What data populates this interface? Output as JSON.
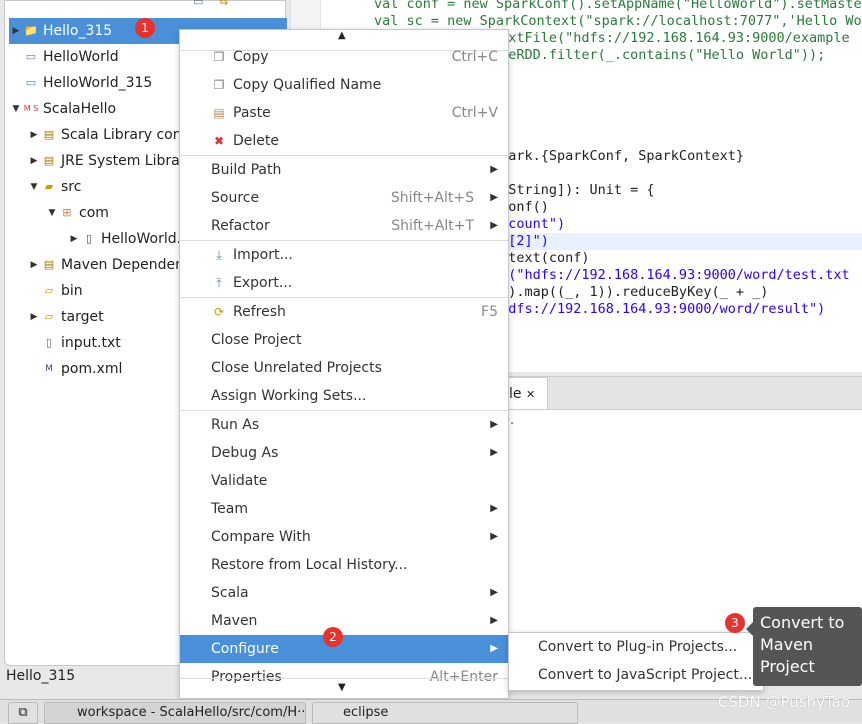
{
  "explorer": {
    "items": [
      {
        "label": "Hello_315",
        "selected": true,
        "icon": "maven-scala-project-icon"
      },
      {
        "label": "HelloWorld",
        "icon": "folder-project-icon"
      },
      {
        "label": "HelloWorld_315",
        "icon": "folder-project-icon"
      },
      {
        "label": "ScalaHello",
        "icon": "maven-scala-project-icon"
      },
      {
        "label": "Scala Library conta",
        "icon": "library-icon"
      },
      {
        "label": "JRE System Librar",
        "icon": "library-icon"
      },
      {
        "label": "src",
        "icon": "source-folder-icon"
      },
      {
        "label": "com",
        "icon": "package-icon"
      },
      {
        "label": "HelloWorld.",
        "icon": "scala-file-icon"
      },
      {
        "label": "Maven Dependenc",
        "icon": "library-icon"
      },
      {
        "label": "bin",
        "icon": "folder-icon"
      },
      {
        "label": "target",
        "icon": "folder-icon"
      },
      {
        "label": "input.txt",
        "icon": "text-file-icon"
      },
      {
        "label": "pom.xml",
        "icon": "xml-file-icon"
      }
    ]
  },
  "editor": {
    "lines": [
      "val conf = new SparkConf().setAppName(\"HelloWorld\").setMaster",
      "val sc = new SparkContext(\"spark://localhost:7077\",'Hello Wor",
      "textFile(\"hdfs://192.168.164.93:9000/example",
      "ileRDD.filter(_.contains(\"Hello World\"));",
      ";",
      ";",
      "spark.{SparkConf, SparkContext}",
      "y[String]): Unit = {",
      "kConf()",
      "rdcount\")",
      "al[2]\")",
      "ontext(conf)",
      "le(\"hdfs://192.168.164.93:9000/word/test.txt",
      "\")).map((_, 1)).reduceByKey(_ + _)",
      "\"hdfs://192.168.164.93:9000/word/result\")"
    ]
  },
  "bottom_panel": {
    "tab_label": "le",
    "tab_close": "✕",
    "text": "e."
  },
  "context_menu": {
    "items": [
      {
        "label": "Copy",
        "shortcut": "Ctrl+C"
      },
      {
        "label": "Copy Qualified Name"
      },
      {
        "label": "Paste",
        "shortcut": "Ctrl+V"
      },
      {
        "label": "Delete"
      },
      {
        "label": "Build Path"
      },
      {
        "label": "Source",
        "shortcut": "Shift+Alt+S"
      },
      {
        "label": "Refactor",
        "shortcut": "Shift+Alt+T"
      },
      {
        "label": "Import..."
      },
      {
        "label": "Export..."
      },
      {
        "label": "Refresh",
        "shortcut": "F5"
      },
      {
        "label": "Close Project"
      },
      {
        "label": "Close Unrelated Projects"
      },
      {
        "label": "Assign Working Sets..."
      },
      {
        "label": "Run As"
      },
      {
        "label": "Debug As"
      },
      {
        "label": "Validate"
      },
      {
        "label": "Team"
      },
      {
        "label": "Compare With"
      },
      {
        "label": "Restore from Local History..."
      },
      {
        "label": "Scala"
      },
      {
        "label": "Maven"
      },
      {
        "label": "Configure"
      },
      {
        "label": "Properties",
        "shortcut": "Alt+Enter"
      }
    ]
  },
  "submenu": {
    "items": [
      "Convert to Plug-in Projects...",
      "Convert to JavaScript Project..."
    ]
  },
  "tooltip": "Convert to Maven Project",
  "badges": [
    "1",
    "2",
    "3"
  ],
  "status": "Hello_315",
  "taskbar": {
    "tasks": [
      "workspace - ScalaHello/src/com/H···",
      "eclipse"
    ]
  },
  "watermark": "CSDN @PushyTao",
  "colors": {
    "selection": "#4a90d9",
    "badge": "#e8322e",
    "tooltip": "#555555"
  }
}
